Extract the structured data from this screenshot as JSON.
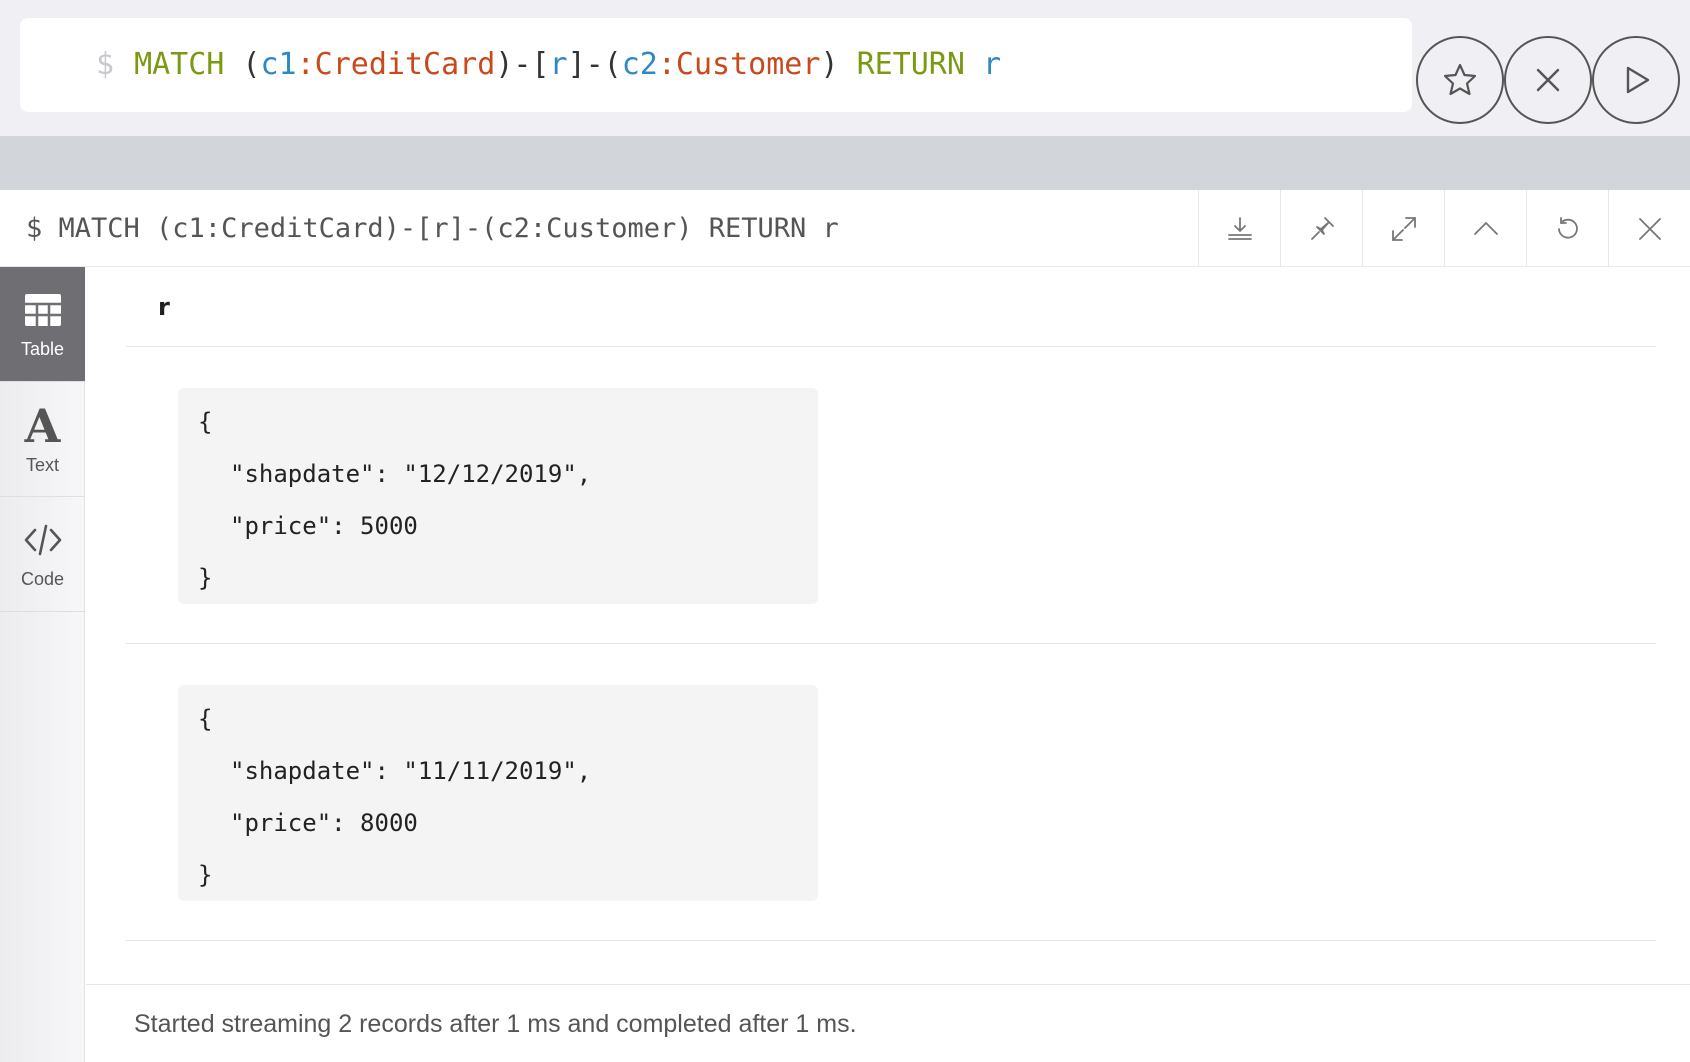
{
  "editor": {
    "prompt": "$",
    "query_tokens": [
      {
        "t": "MATCH",
        "k": "kw"
      },
      {
        "t": " (",
        "k": "punct"
      },
      {
        "t": "c1",
        "k": "var"
      },
      {
        "t": ":CreditCard",
        "k": "label"
      },
      {
        "t": ")-[",
        "k": "punct"
      },
      {
        "t": "r",
        "k": "var"
      },
      {
        "t": "]-(",
        "k": "punct"
      },
      {
        "t": "c2",
        "k": "var"
      },
      {
        "t": ":Customer",
        "k": "label"
      },
      {
        "t": ") ",
        "k": "punct"
      },
      {
        "t": "RETURN",
        "k": "kw"
      },
      {
        "t": " ",
        "k": "punct"
      },
      {
        "t": "r",
        "k": "var"
      }
    ],
    "buttons": [
      "star-icon",
      "close-circle-icon",
      "play-icon"
    ]
  },
  "frame": {
    "title": "$ MATCH (c1:CreditCard)-[r]-(c2:Customer) RETURN r",
    "actions": [
      "download-icon",
      "pin-icon",
      "expand-icon",
      "collapse-icon",
      "rerun-icon",
      "close-icon"
    ]
  },
  "sidebar": {
    "tabs": [
      {
        "label": "Table",
        "icon": "table-icon",
        "active": true
      },
      {
        "label": "Text",
        "icon": "text-icon",
        "active": false
      },
      {
        "label": "Code",
        "icon": "code-icon",
        "active": false
      }
    ]
  },
  "table": {
    "column": "r",
    "rows": [
      {
        "open": "{",
        "lines": [
          "\"shapdate\": \"12/12/2019\",",
          "\"price\": 5000"
        ],
        "close": "}"
      },
      {
        "open": "{",
        "lines": [
          "\"shapdate\": \"11/11/2019\",",
          "\"price\": 8000"
        ],
        "close": "}"
      }
    ]
  },
  "status": {
    "text": "Started streaming 2 records after 1 ms and completed after 1 ms."
  }
}
